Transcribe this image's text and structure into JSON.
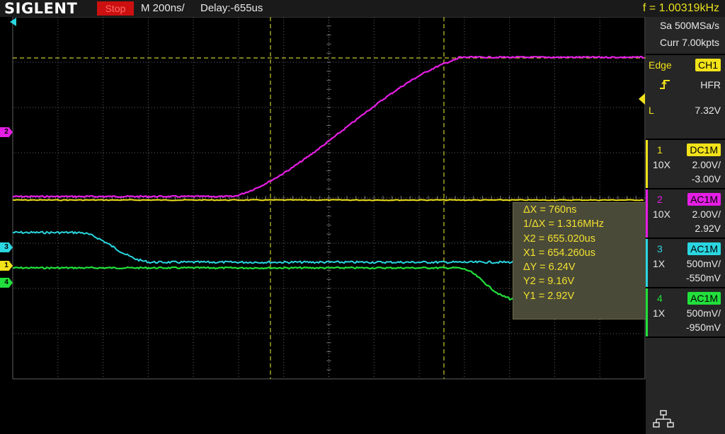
{
  "header": {
    "logo": "SIGLENT",
    "status": "Stop",
    "timebase": "M 200ns/",
    "delay": "Delay:-655us",
    "frequency": "f = 1.00319kHz"
  },
  "acquisition": {
    "sample_rate": "Sa 500MSa/s",
    "memory": "Curr 7.00kpts"
  },
  "trigger": {
    "type": "Edge",
    "source": "CH1",
    "coupling": "HFR",
    "level_label": "L",
    "level": "7.32V"
  },
  "channels": [
    {
      "num": "1",
      "coupling": "DC1M",
      "probe": "10X",
      "scale": "2.00V/",
      "offset": "-3.00V",
      "color": "#f2e21a"
    },
    {
      "num": "2",
      "coupling": "AC1M",
      "probe": "10X",
      "scale": "2.00V/",
      "offset": "2.92V",
      "color": "#e51ee5"
    },
    {
      "num": "3",
      "coupling": "AC1M",
      "probe": "1X",
      "scale": "500mV/",
      "offset": "-550mV",
      "color": "#2ad6e0"
    },
    {
      "num": "4",
      "coupling": "AC1M",
      "probe": "1X",
      "scale": "500mV/",
      "offset": "-950mV",
      "color": "#22e03c"
    }
  ],
  "cursors": {
    "dx": "ΔX = 760ns",
    "inv_dx": "1/ΔX = 1.316MHz",
    "x2": "X2 = 655.020us",
    "x1": "X1 = 654.260us",
    "dy": "ΔY = 6.24V",
    "y2": "Y2 = 9.16V",
    "y1": "Y1 = 2.92V"
  },
  "markers": {
    "ch1": "1",
    "ch2": "2",
    "ch3": "3",
    "ch4": "4"
  },
  "icons": {
    "network": "network-icon",
    "trigger_edge": "rising-edge-icon",
    "trigger_pos": "trigger-position-icon"
  },
  "colors": {
    "grid": "#555555",
    "cursor": "#c8c830",
    "panel": "#262626"
  }
}
